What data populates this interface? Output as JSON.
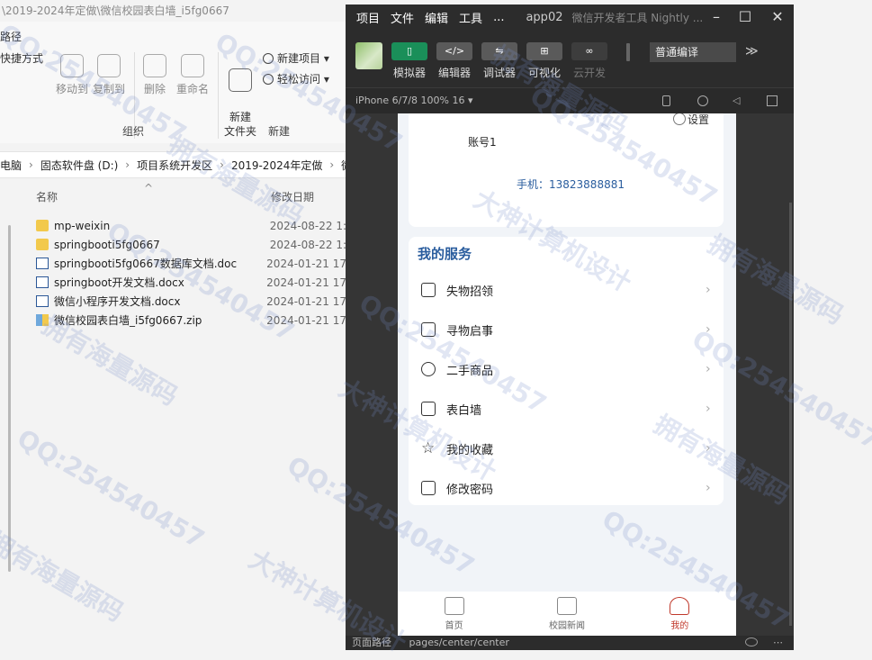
{
  "explorer": {
    "title": "\\2019-2024年定做\\微信校园表白墙_i5fg0667",
    "ribbon": {
      "path_label": "路径",
      "shortcut_label": "快捷方式",
      "move_to": "移动到",
      "copy_to": "复制到",
      "delete": "删除",
      "rename": "重命名",
      "new_folder": "新建\n文件夹",
      "new_item": "新建项目 ▾",
      "easy_access": "轻松访问 ▾",
      "group_organize": "组织",
      "group_new": "新建"
    },
    "address": [
      "电脑",
      "固态软件盘 (D:)",
      "项目系统开发区",
      "2019-2024年定做",
      "微"
    ],
    "columns": {
      "name": "名称",
      "modified": "修改日期"
    },
    "files": [
      {
        "name": "mp-weixin",
        "date": "2024-08-22 1:",
        "type": "folder"
      },
      {
        "name": "springbooti5fg0667",
        "date": "2024-08-22 1:",
        "type": "folder"
      },
      {
        "name": "springbooti5fg0667数据库文档.doc",
        "date": "2024-01-21 17",
        "type": "doc"
      },
      {
        "name": "springboot开发文档.docx",
        "date": "2024-01-21 17",
        "type": "doc"
      },
      {
        "name": "微信小程序开发文档.docx",
        "date": "2024-01-21 17",
        "type": "doc"
      },
      {
        "name": "微信校园表白墙_i5fg0667.zip",
        "date": "2024-01-21 17",
        "type": "zip"
      }
    ]
  },
  "devtools": {
    "menu": [
      "项目",
      "文件",
      "编辑",
      "工具",
      "..."
    ],
    "app_name": "app02",
    "subtitle": "微信开发者工具 Nightly ...",
    "toolbar": {
      "simulator": "模拟器",
      "editor": "编辑器",
      "debugger": "调试器",
      "visual": "可视化",
      "cloud": "云开发",
      "compile": "普通编译",
      "more": "≫"
    },
    "device": "iPhone 6/7/8 100% 16 ▾",
    "status": {
      "label": "页面路径",
      "path": "pages/center/center"
    }
  },
  "phone": {
    "settings": "设置",
    "account": "账号1",
    "phone_line": "手机：13823888881",
    "services_title": "我的服务",
    "services": [
      {
        "label": "失物招领",
        "icon": "glasses-icon"
      },
      {
        "label": "寻物启事",
        "icon": "notice-icon"
      },
      {
        "label": "二手商品",
        "icon": "yen-icon"
      },
      {
        "label": "表白墙",
        "icon": "image-icon"
      },
      {
        "label": "我的收藏",
        "icon": "star-icon"
      },
      {
        "label": "修改密码",
        "icon": "lock-icon"
      }
    ],
    "tabs": [
      {
        "label": "首页",
        "icon": "home-icon"
      },
      {
        "label": "校园新闻",
        "icon": "news-icon"
      },
      {
        "label": "我的",
        "icon": "user-icon"
      }
    ]
  },
  "watermarks": {
    "qq": "QQ:254540457",
    "slogan1": "大神计算机设计",
    "slogan2": "拥有海量源码"
  }
}
